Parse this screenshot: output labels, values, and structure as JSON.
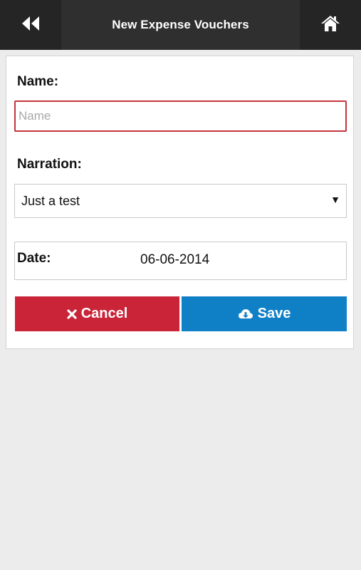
{
  "header": {
    "title": "New Expense Vouchers",
    "back_icon": "double-chevron-left-icon",
    "home_icon": "home-icon"
  },
  "form": {
    "name_label": "Name:",
    "name_placeholder": "Name",
    "name_value": "",
    "narration_label": "Narration:",
    "narration_selected": "Just a test",
    "date_label": "Date:",
    "date_value": "06-06-2014"
  },
  "buttons": {
    "cancel_label": "Cancel",
    "cancel_icon": "close-icon",
    "save_label": "Save",
    "save_icon": "cloud-download-icon"
  },
  "colors": {
    "header_bg": "#2f2f2f",
    "cancel_bg": "#c92438",
    "save_bg": "#1080c6",
    "invalid_border": "#c4343d"
  }
}
